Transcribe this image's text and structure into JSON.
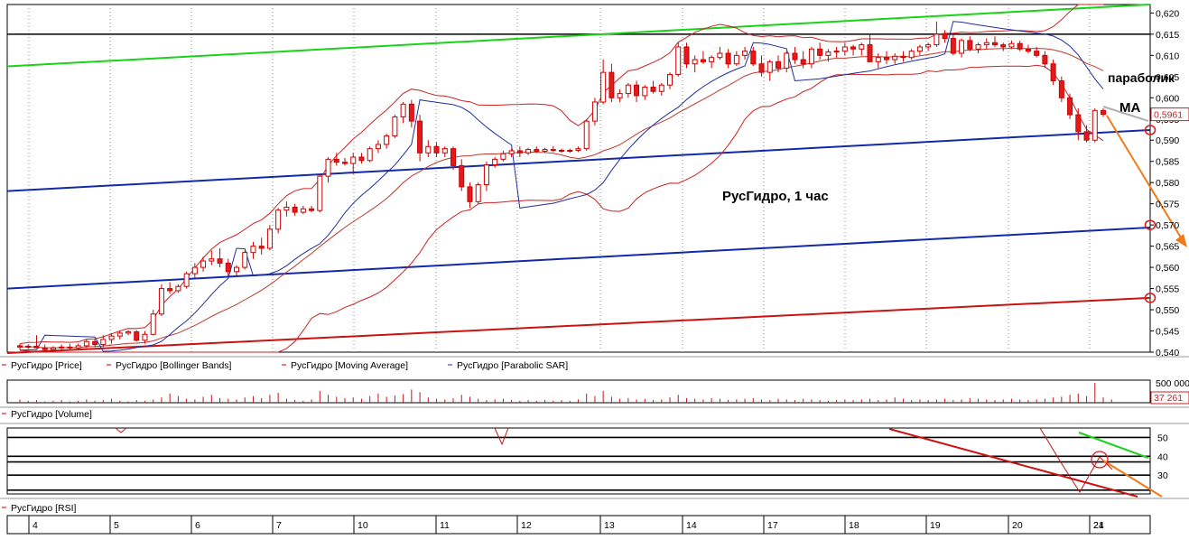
{
  "chart_data": {
    "type": "candlestick",
    "title": "РусГидро,  1 час",
    "annotations": {
      "parabolic": "параболик",
      "ma": "МА"
    },
    "colors": {
      "up": "#ffffff",
      "down": "#e31a1c",
      "candle_outline": "#cc0000",
      "bollinger": "#cc2222",
      "moving_average": "#c0392b",
      "sar": "#1f2f9e",
      "green_line": "#19d219",
      "blue_channel": "#1429a8",
      "red_line": "#cc1111",
      "orange_arrow": "#f07a1a",
      "grey_arrow": "#b0b0b0"
    },
    "price_axis": {
      "ylim": [
        0.54,
        0.622
      ],
      "ticks": [
        "0,540",
        "0,545",
        "0,550",
        "0,555",
        "0,560",
        "0,565",
        "0,570",
        "0,575",
        "0,580",
        "0,585",
        "0,590",
        "0,595",
        "0,600",
        "0,605",
        "0,610",
        "0,615",
        "0,620"
      ],
      "last_price_label": "0,5961",
      "last_price": 0.5961
    },
    "horizontal_level": 0.615,
    "trendlines": [
      {
        "color": "green_line",
        "from": [
          0,
          0.6074
        ],
        "to": [
          1,
          0.622
        ]
      },
      {
        "color": "blue_channel",
        "from": [
          0,
          0.578
        ],
        "to": [
          1,
          0.5924
        ]
      },
      {
        "color": "blue_channel",
        "from": [
          0,
          0.555
        ],
        "to": [
          1,
          0.5694
        ]
      },
      {
        "color": "red_line",
        "from": [
          0,
          0.5398
        ],
        "to": [
          1,
          0.5528
        ]
      }
    ],
    "circled_levels": [
      0.5924,
      0.57,
      0.5528
    ],
    "x_labels": [
      "4",
      "5",
      "6",
      "7",
      "10",
      "11",
      "12",
      "13",
      "14",
      "17",
      "18",
      "19",
      "20",
      "21",
      "24"
    ],
    "candles": [
      [
        0.5415,
        0.542,
        0.5405,
        0.5412
      ],
      [
        0.5412,
        0.5418,
        0.5408,
        0.5414
      ],
      [
        0.5414,
        0.544,
        0.541,
        0.541
      ],
      [
        0.541,
        0.5418,
        0.5402,
        0.5406
      ],
      [
        0.5406,
        0.5414,
        0.5402,
        0.541
      ],
      [
        0.541,
        0.5418,
        0.5405,
        0.5412
      ],
      [
        0.5412,
        0.542,
        0.5405,
        0.541
      ],
      [
        0.541,
        0.542,
        0.5405,
        0.5415
      ],
      [
        0.5415,
        0.543,
        0.541,
        0.5425
      ],
      [
        0.5425,
        0.5432,
        0.5412,
        0.5418
      ],
      [
        0.5418,
        0.544,
        0.5412,
        0.543
      ],
      [
        0.543,
        0.5445,
        0.542,
        0.5438
      ],
      [
        0.5438,
        0.545,
        0.543,
        0.5445
      ],
      [
        0.5445,
        0.5452,
        0.544,
        0.5448
      ],
      [
        0.5448,
        0.5452,
        0.5425,
        0.5428
      ],
      [
        0.5428,
        0.545,
        0.542,
        0.5442
      ],
      [
        0.5442,
        0.55,
        0.544,
        0.549
      ],
      [
        0.549,
        0.556,
        0.5485,
        0.555
      ],
      [
        0.555,
        0.5565,
        0.5538,
        0.5545
      ],
      [
        0.5545,
        0.556,
        0.554,
        0.5555
      ],
      [
        0.5555,
        0.559,
        0.555,
        0.5585
      ],
      [
        0.5585,
        0.561,
        0.5575,
        0.56
      ],
      [
        0.56,
        0.5625,
        0.559,
        0.5615
      ],
      [
        0.5615,
        0.564,
        0.5605,
        0.562
      ],
      [
        0.562,
        0.5645,
        0.56,
        0.561
      ],
      [
        0.561,
        0.562,
        0.558,
        0.559
      ],
      [
        0.559,
        0.5605,
        0.558,
        0.56
      ],
      [
        0.56,
        0.564,
        0.5595,
        0.5635
      ],
      [
        0.5635,
        0.566,
        0.562,
        0.565
      ],
      [
        0.565,
        0.567,
        0.563,
        0.5645
      ],
      [
        0.5645,
        0.57,
        0.564,
        0.569
      ],
      [
        0.569,
        0.574,
        0.568,
        0.5735
      ],
      [
        0.5735,
        0.5755,
        0.572,
        0.5742
      ],
      [
        0.5742,
        0.575,
        0.5722,
        0.573
      ],
      [
        0.573,
        0.5745,
        0.5725,
        0.5738
      ],
      [
        0.5738,
        0.5745,
        0.573,
        0.5734
      ],
      [
        0.5734,
        0.582,
        0.573,
        0.5815
      ],
      [
        0.5815,
        0.586,
        0.58,
        0.5855
      ],
      [
        0.5855,
        0.587,
        0.584,
        0.5848
      ],
      [
        0.5848,
        0.5858,
        0.584,
        0.5845
      ],
      [
        0.5845,
        0.587,
        0.582,
        0.586
      ],
      [
        0.586,
        0.587,
        0.5845,
        0.5852
      ],
      [
        0.5852,
        0.5885,
        0.5848,
        0.588
      ],
      [
        0.588,
        0.59,
        0.587,
        0.589
      ],
      [
        0.589,
        0.5915,
        0.588,
        0.591
      ],
      [
        0.591,
        0.596,
        0.5905,
        0.5955
      ],
      [
        0.5955,
        0.599,
        0.594,
        0.5985
      ],
      [
        0.5985,
        0.5995,
        0.593,
        0.5945
      ],
      [
        0.5945,
        0.596,
        0.585,
        0.587
      ],
      [
        0.587,
        0.59,
        0.586,
        0.5885
      ],
      [
        0.5885,
        0.5895,
        0.586,
        0.587
      ],
      [
        0.587,
        0.5885,
        0.586,
        0.588
      ],
      [
        0.588,
        0.5885,
        0.583,
        0.584
      ],
      [
        0.584,
        0.5855,
        0.578,
        0.579
      ],
      [
        0.579,
        0.58,
        0.574,
        0.5755
      ],
      [
        0.5755,
        0.58,
        0.575,
        0.5795
      ],
      [
        0.5795,
        0.585,
        0.578,
        0.5842
      ],
      [
        0.5842,
        0.586,
        0.5835,
        0.5855
      ],
      [
        0.5855,
        0.5875,
        0.585,
        0.5868
      ],
      [
        0.5868,
        0.588,
        0.586,
        0.5875
      ],
      [
        0.5875,
        0.5885,
        0.586,
        0.587
      ],
      [
        0.587,
        0.5882,
        0.5865,
        0.5878
      ],
      [
        0.5878,
        0.5885,
        0.587,
        0.5874
      ],
      [
        0.5874,
        0.5882,
        0.587,
        0.5878
      ],
      [
        0.5878,
        0.5886,
        0.5872,
        0.5876
      ],
      [
        0.5876,
        0.588,
        0.587,
        0.5874
      ],
      [
        0.5874,
        0.588,
        0.587,
        0.5876
      ],
      [
        0.5876,
        0.5885,
        0.5872,
        0.588
      ],
      [
        0.588,
        0.595,
        0.5875,
        0.5945
      ],
      [
        0.5945,
        0.6,
        0.5935,
        0.599
      ],
      [
        0.599,
        0.609,
        0.5985,
        0.606
      ],
      [
        0.606,
        0.608,
        0.599,
        0.6
      ],
      [
        0.6,
        0.602,
        0.599,
        0.601
      ],
      [
        0.601,
        0.6035,
        0.6,
        0.603
      ],
      [
        0.603,
        0.604,
        0.599,
        0.6005
      ],
      [
        0.6005,
        0.603,
        0.5995,
        0.6025
      ],
      [
        0.6025,
        0.604,
        0.601,
        0.6015
      ],
      [
        0.6015,
        0.6035,
        0.6005,
        0.603
      ],
      [
        0.603,
        0.606,
        0.602,
        0.6055
      ],
      [
        0.6055,
        0.613,
        0.605,
        0.612
      ],
      [
        0.612,
        0.613,
        0.607,
        0.608
      ],
      [
        0.608,
        0.61,
        0.606,
        0.609
      ],
      [
        0.609,
        0.611,
        0.608,
        0.6085
      ],
      [
        0.6085,
        0.61,
        0.607,
        0.6095
      ],
      [
        0.6095,
        0.612,
        0.609,
        0.6105
      ],
      [
        0.6105,
        0.6115,
        0.607,
        0.608
      ],
      [
        0.608,
        0.611,
        0.6075,
        0.61
      ],
      [
        0.61,
        0.612,
        0.609,
        0.611
      ],
      [
        0.611,
        0.612,
        0.6075,
        0.608
      ],
      [
        0.608,
        0.61,
        0.605,
        0.606
      ],
      [
        0.606,
        0.609,
        0.604,
        0.6085
      ],
      [
        0.6085,
        0.61,
        0.606,
        0.607
      ],
      [
        0.607,
        0.611,
        0.606,
        0.6105
      ],
      [
        0.6105,
        0.612,
        0.608,
        0.609
      ],
      [
        0.609,
        0.611,
        0.607,
        0.608
      ],
      [
        0.608,
        0.612,
        0.607,
        0.6115
      ],
      [
        0.6115,
        0.613,
        0.609,
        0.61
      ],
      [
        0.61,
        0.6115,
        0.6085,
        0.6108
      ],
      [
        0.6108,
        0.612,
        0.6095,
        0.611
      ],
      [
        0.611,
        0.613,
        0.61,
        0.612
      ],
      [
        0.612,
        0.6125,
        0.61,
        0.6115
      ],
      [
        0.6115,
        0.613,
        0.61,
        0.6125
      ],
      [
        0.6125,
        0.615,
        0.609,
        0.6085
      ],
      [
        0.6085,
        0.6105,
        0.607,
        0.6095
      ],
      [
        0.6095,
        0.611,
        0.608,
        0.609
      ],
      [
        0.609,
        0.6105,
        0.608,
        0.6098
      ],
      [
        0.6098,
        0.611,
        0.6085,
        0.6095
      ],
      [
        0.6095,
        0.6115,
        0.609,
        0.611
      ],
      [
        0.611,
        0.6125,
        0.61,
        0.612
      ],
      [
        0.612,
        0.613,
        0.611,
        0.6125
      ],
      [
        0.6125,
        0.618,
        0.612,
        0.615
      ],
      [
        0.615,
        0.616,
        0.613,
        0.614
      ],
      [
        0.614,
        0.615,
        0.61,
        0.6105
      ],
      [
        0.6105,
        0.614,
        0.6095,
        0.6135
      ],
      [
        0.6135,
        0.6145,
        0.611,
        0.6115
      ],
      [
        0.6115,
        0.613,
        0.6105,
        0.6125
      ],
      [
        0.6125,
        0.614,
        0.6115,
        0.613
      ],
      [
        0.613,
        0.6145,
        0.612,
        0.6125
      ],
      [
        0.6125,
        0.613,
        0.611,
        0.612
      ],
      [
        0.612,
        0.6135,
        0.6115,
        0.6128
      ],
      [
        0.6128,
        0.6135,
        0.611,
        0.6115
      ],
      [
        0.6115,
        0.6125,
        0.6105,
        0.611
      ],
      [
        0.611,
        0.612,
        0.6095,
        0.61
      ],
      [
        0.61,
        0.611,
        0.607,
        0.608
      ],
      [
        0.608,
        0.609,
        0.603,
        0.604
      ],
      [
        0.604,
        0.605,
        0.599,
        0.6
      ],
      [
        0.6,
        0.601,
        0.595,
        0.596
      ],
      [
        0.596,
        0.5975,
        0.59,
        0.592
      ],
      [
        0.592,
        0.5935,
        0.5895,
        0.59
      ],
      [
        0.59,
        0.5975,
        0.5895,
        0.597
      ],
      [
        0.597,
        0.5975,
        0.5955,
        0.5961
      ]
    ],
    "volume_axis": {
      "ticks": [
        "500 000"
      ],
      "last_value_label": "37 261"
    },
    "volume": [
      5,
      3,
      4,
      2,
      3,
      4,
      2,
      3,
      5,
      3,
      4,
      6,
      3,
      2,
      4,
      3,
      5,
      8,
      14,
      10,
      6,
      5,
      9,
      12,
      7,
      6,
      5,
      8,
      10,
      7,
      12,
      15,
      6,
      4,
      3,
      5,
      18,
      12,
      9,
      7,
      8,
      6,
      10,
      14,
      9,
      11,
      13,
      20,
      16,
      8,
      6,
      5,
      7,
      12,
      9,
      6,
      4,
      5,
      6,
      4,
      3,
      4,
      3,
      4,
      3,
      4,
      3,
      5,
      14,
      10,
      18,
      9,
      6,
      7,
      5,
      6,
      4,
      5,
      8,
      12,
      7,
      6,
      5,
      7,
      6,
      4,
      5,
      6,
      7,
      5,
      4,
      6,
      5,
      4,
      6,
      5,
      4,
      3,
      4,
      5,
      4,
      5,
      6,
      4,
      5,
      8,
      6,
      4,
      5,
      4,
      5,
      6,
      4,
      5,
      7,
      6,
      5,
      4,
      5,
      6,
      5,
      4,
      5,
      6,
      8,
      9,
      12,
      14,
      10,
      30,
      8,
      5
    ],
    "rsi_axis": {
      "ticks": [
        "30",
        "40",
        "50"
      ],
      "ylim": [
        20,
        55
      ]
    },
    "legend_price": [
      "РусГидро [Price]",
      "РусГидро [Bollinger Bands]",
      "РусГидро [Moving Average]",
      "РусГидро [Parabolic SAR]"
    ],
    "legend_volume": "РусГидро [Volume]",
    "legend_rsi": "РусГидро [RSI]"
  }
}
